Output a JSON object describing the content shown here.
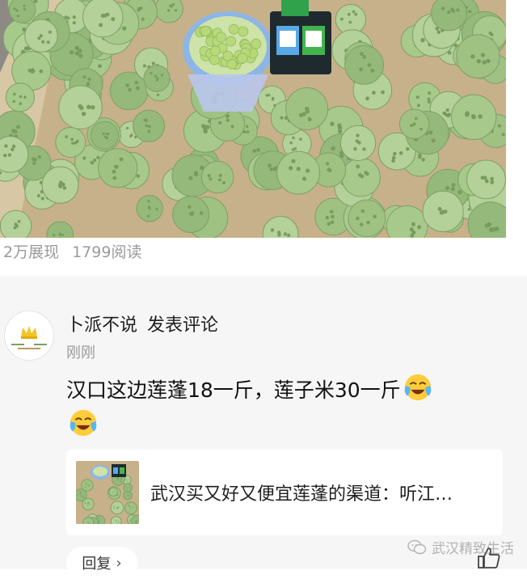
{
  "stats": {
    "impressions": "2万展现",
    "reads": "1799阅读"
  },
  "comment": {
    "author": "卜派不说",
    "action": "发表评论",
    "time": "刚刚",
    "text": "汉口这边莲蓬18一斤，莲子米30一斤",
    "emojis": [
      "crying-laughing-emoji",
      "crying-laughing-emoji"
    ]
  },
  "link_card": {
    "title": "武汉买又好又便宜莲蓬的渠道：听江…"
  },
  "reply": {
    "label": "回复"
  },
  "watermark": {
    "text": "武汉精致生活"
  },
  "colors": {
    "lotus_green": "#a9c98e",
    "crate_wood": "#c9b58e",
    "section_gray": "#f6f6f6",
    "stat_gray": "#9a9a9a"
  }
}
